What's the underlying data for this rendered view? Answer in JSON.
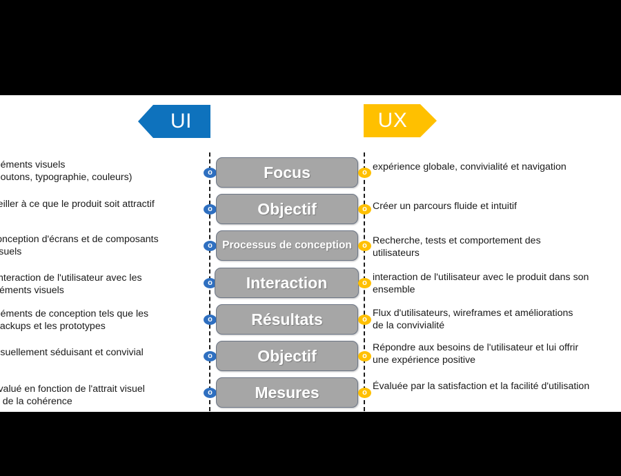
{
  "banners": {
    "left": {
      "label": "UI",
      "color": "#0e72bd"
    },
    "right": {
      "label": "UX",
      "color": "#ffc000"
    }
  },
  "marker_glyph": "o",
  "bar_color": "#a6a6a6",
  "rows": [
    {
      "center": "Focus",
      "ui": [
        "Éléments visuels",
        "(boutons, typographie,  couleurs)"
      ],
      "ux": [
        "expérience globale, convivialité et navigation"
      ]
    },
    {
      "center": "Objectif",
      "ui": [
        "Veiller à ce que le produit soit attractif"
      ],
      "ux": [
        " Créer un parcours fluide et intuitif"
      ]
    },
    {
      "center": "Processus de conception",
      "ui": [
        "conception d'écrans et de composants",
        "visuels"
      ],
      "ux": [
        "Recherche, tests et comportement des",
        "utilisateurs"
      ]
    },
    {
      "center": "Interaction",
      "ui": [
        "l'interaction de l'utilisateur avec les",
        "éléments visuels"
      ],
      "ux": [
        "interaction de l'utilisateur avec le produit dans son",
        "ensemble"
      ]
    },
    {
      "center": "Résultats",
      "ui": [
        "Éléments de conception tels que les",
        "mackups et les prototypes"
      ],
      "ux": [
        "Flux d'utilisateurs, wireframes et améliorations",
        "de la convivialité"
      ]
    },
    {
      "center": "Objectif",
      "ui": [
        " Visuellement séduisant et convivial"
      ],
      "ux": [
        "Répondre aux besoins de l'utilisateur et lui offrir",
        "une expérience positive"
      ]
    },
    {
      "center": "Mesures",
      "ui": [
        "Évalué en fonction de l'attrait visuel",
        "et de la cohérence"
      ],
      "ux": [
        " Évaluée par la satisfaction et la facilité d'utilisation"
      ]
    }
  ]
}
